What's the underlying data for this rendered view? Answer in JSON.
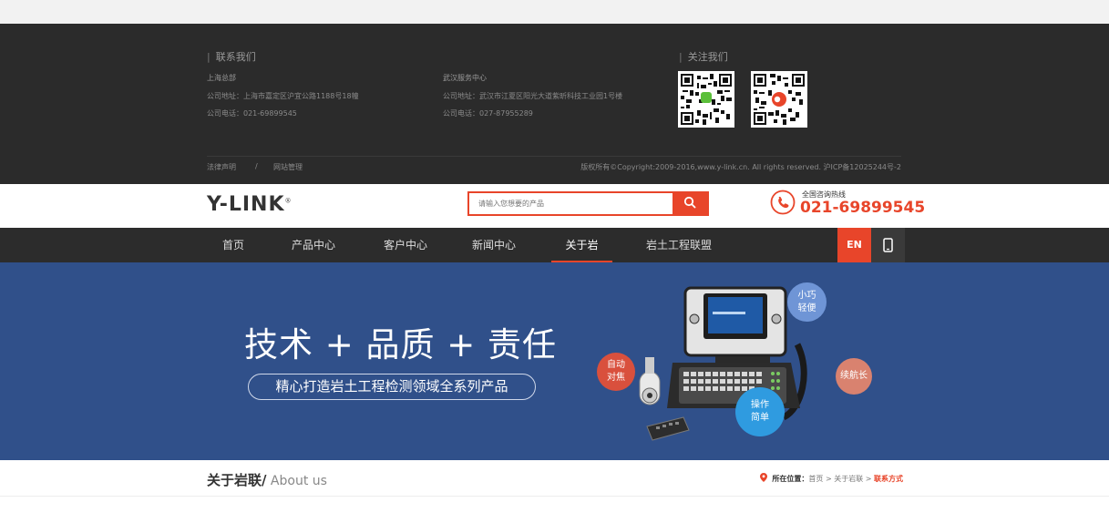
{
  "footer": {
    "contact_title": "联系我们",
    "follow_title": "关注我们",
    "shanghai": {
      "name": "上海总部",
      "address": "公司地址：上海市嘉定区沪宜公路1188号18幢",
      "phone": "公司电话：021-69899545"
    },
    "wuhan": {
      "name": "武汉服务中心",
      "address": "公司地址：武汉市江夏区阳光大道紫昕科技工业园1号楼",
      "phone": "公司电话：027-87955289"
    },
    "legal": "法律声明",
    "sep": "/",
    "site_admin": "网站管理",
    "copyright": "版权所有©Copyright:2009-2016,www.y-link.cn. All rights reserved. 沪ICP备12025244号-2"
  },
  "header": {
    "logo": "Y-LINK",
    "logo_mark": "®",
    "search_placeholder": "请输入您想要的产品",
    "hotline_label": "全国咨询热线",
    "hotline_number": "021-69899545"
  },
  "nav": {
    "items": [
      "首页",
      "产品中心",
      "客户中心",
      "新闻中心",
      "关于岩联",
      "岩土工程联盟"
    ],
    "active": "关于岩联",
    "en_label": "EN"
  },
  "banner": {
    "slogan": "技术 + 品质 + 责任",
    "subtitle": "精心打造岩土工程检测领域全系列产品",
    "bubbles": {
      "small": "小巧\n轻便",
      "auto": "自动\n对焦",
      "battery": "续航长",
      "easy": "操作\n简单"
    }
  },
  "page": {
    "title": "关于岩联/",
    "title_en": " About us",
    "crumb_label": "所在位置：",
    "crumb_home": "首页",
    "crumb_sep": " > ",
    "crumb_about": "关于岩联",
    "crumb_current": "联系方式"
  },
  "colors": {
    "accent": "#e8452a",
    "footer_bg": "#2b2b2b",
    "nav_bg": "#2c2c2c",
    "banner_bg": "#30508a"
  }
}
